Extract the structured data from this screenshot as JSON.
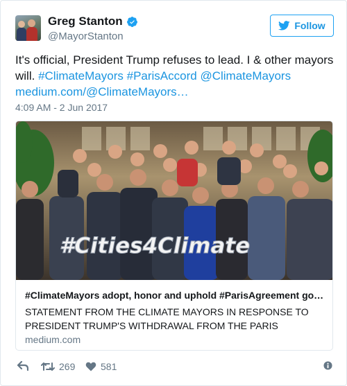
{
  "user": {
    "name": "Greg Stanton",
    "handle": "@MayorStanton"
  },
  "follow": {
    "label": "Follow"
  },
  "tweet": {
    "text_line1": "It's official, President Trump refuses to lead. I & other mayors",
    "text_line2_prefix": "will. ",
    "hashtag1": "#ClimateMayors",
    "hashtag2": "#ParisAccord",
    "mention": "@ClimateMayors",
    "link": "medium.com/@ClimateMayors…",
    "timestamp": "4:09 AM - 2 Jun 2017"
  },
  "card": {
    "sign_text": "#Cities4Climate",
    "title": "#ClimateMayors adopt, honor and uphold #ParisAgreement go…",
    "desc_line1": "STATEMENT FROM THE CLIMATE MAYORS IN RESPONSE TO",
    "desc_line2": "PRESIDENT TRUMP'S WITHDRAWAL FROM THE PARIS",
    "domain": "medium.com"
  },
  "stats": {
    "retweets": "269",
    "likes": "581"
  },
  "icons": [
    "verified-icon",
    "twitter-bird-icon",
    "reply-icon",
    "retweet-icon",
    "heart-icon",
    "info-icon"
  ],
  "colors": {
    "accent": "#1da1f2",
    "link": "#1b95e0",
    "muted": "#657786"
  }
}
